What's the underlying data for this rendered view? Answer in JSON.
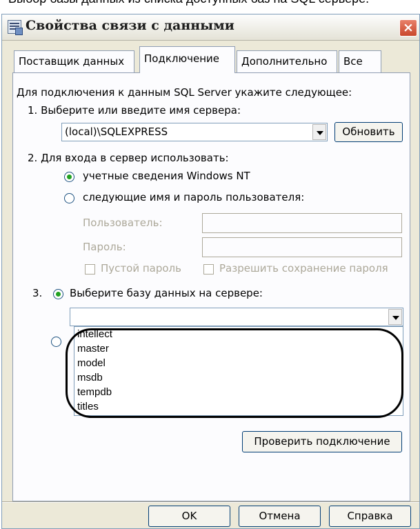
{
  "caption": "Выбор базы данных из списка доступных баз на SQL сервере.",
  "window": {
    "title": "Свойства связи с данными"
  },
  "tabs": [
    {
      "label": "Поставщик данных"
    },
    {
      "label": "Подключение"
    },
    {
      "label": "Дополнительно"
    },
    {
      "label": "Все"
    }
  ],
  "connection": {
    "intro": "Для подключения к данным SQL Server укажите следующее:",
    "step1_label": "1. Выберите или введите имя сервера:",
    "server_value": "(local)\\SQLEXPRESS",
    "refresh_button": "Обновить",
    "step2_label": "2. Для входа в сервер использовать:",
    "auth_windows": "учетные сведения Windows NT",
    "auth_user": "следующие имя и пароль пользователя:",
    "user_label": "Пользователь:",
    "password_label": "Пароль:",
    "empty_password": "Пустой пароль",
    "save_password": "Разрешить сохранение пароля",
    "step3_prefix": "3.",
    "step3_label": "Выберите базу данных на сервере:",
    "databases": [
      "intellect",
      "master",
      "model",
      "msdb",
      "tempdb",
      "titles"
    ],
    "test_button": "Проверить подключение"
  },
  "footer": {
    "ok": "OK",
    "cancel": "Отмена",
    "help": "Справка"
  },
  "colors": {
    "dialog_bg": "#ece9d8",
    "panel_bg": "#fcfcfe",
    "close_button": "#c9472b",
    "radio_dot": "#21a121"
  },
  "icons": [
    "data-link-icon",
    "close-icon",
    "dropdown-arrow-icon"
  ]
}
